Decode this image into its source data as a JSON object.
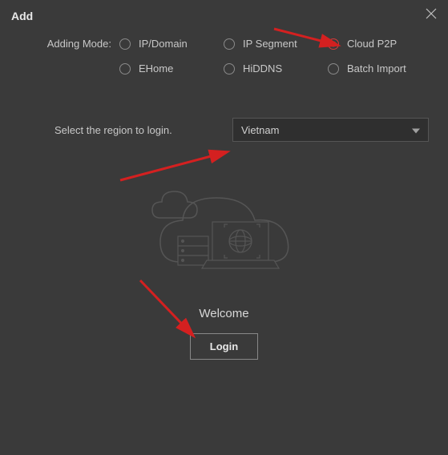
{
  "title": "Add",
  "modes_label": "Adding Mode:",
  "modes": {
    "ip_domain": "IP/Domain",
    "ip_segment": "IP Segment",
    "cloud_p2p": "Cloud P2P",
    "ehome": "EHome",
    "hiddns": "HiDDNS",
    "batch_import": "Batch Import"
  },
  "selected_mode": "cloud_p2p",
  "region_label": "Select the region to login.",
  "region_value": "Vietnam",
  "welcome_text": "Welcome",
  "login_label": "Login"
}
